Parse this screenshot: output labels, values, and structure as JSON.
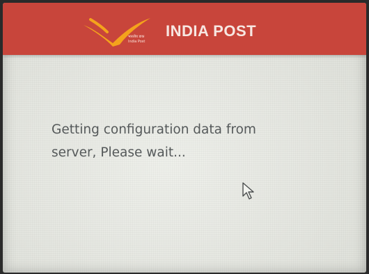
{
  "header": {
    "title": "INDIA POST",
    "logo_icon": "india-post-logo-icon",
    "logo_hindi_text": "भारतीय डाक",
    "logo_english_text": "India Post",
    "background_color": "#c8453b"
  },
  "main": {
    "message_line1": "Getting configuration data from",
    "message_line2": "server, Please wait..."
  },
  "cursor_icon": "mouse-pointer-icon",
  "colors": {
    "logo_chevron": "#f4a31c",
    "text": "#55595a"
  }
}
